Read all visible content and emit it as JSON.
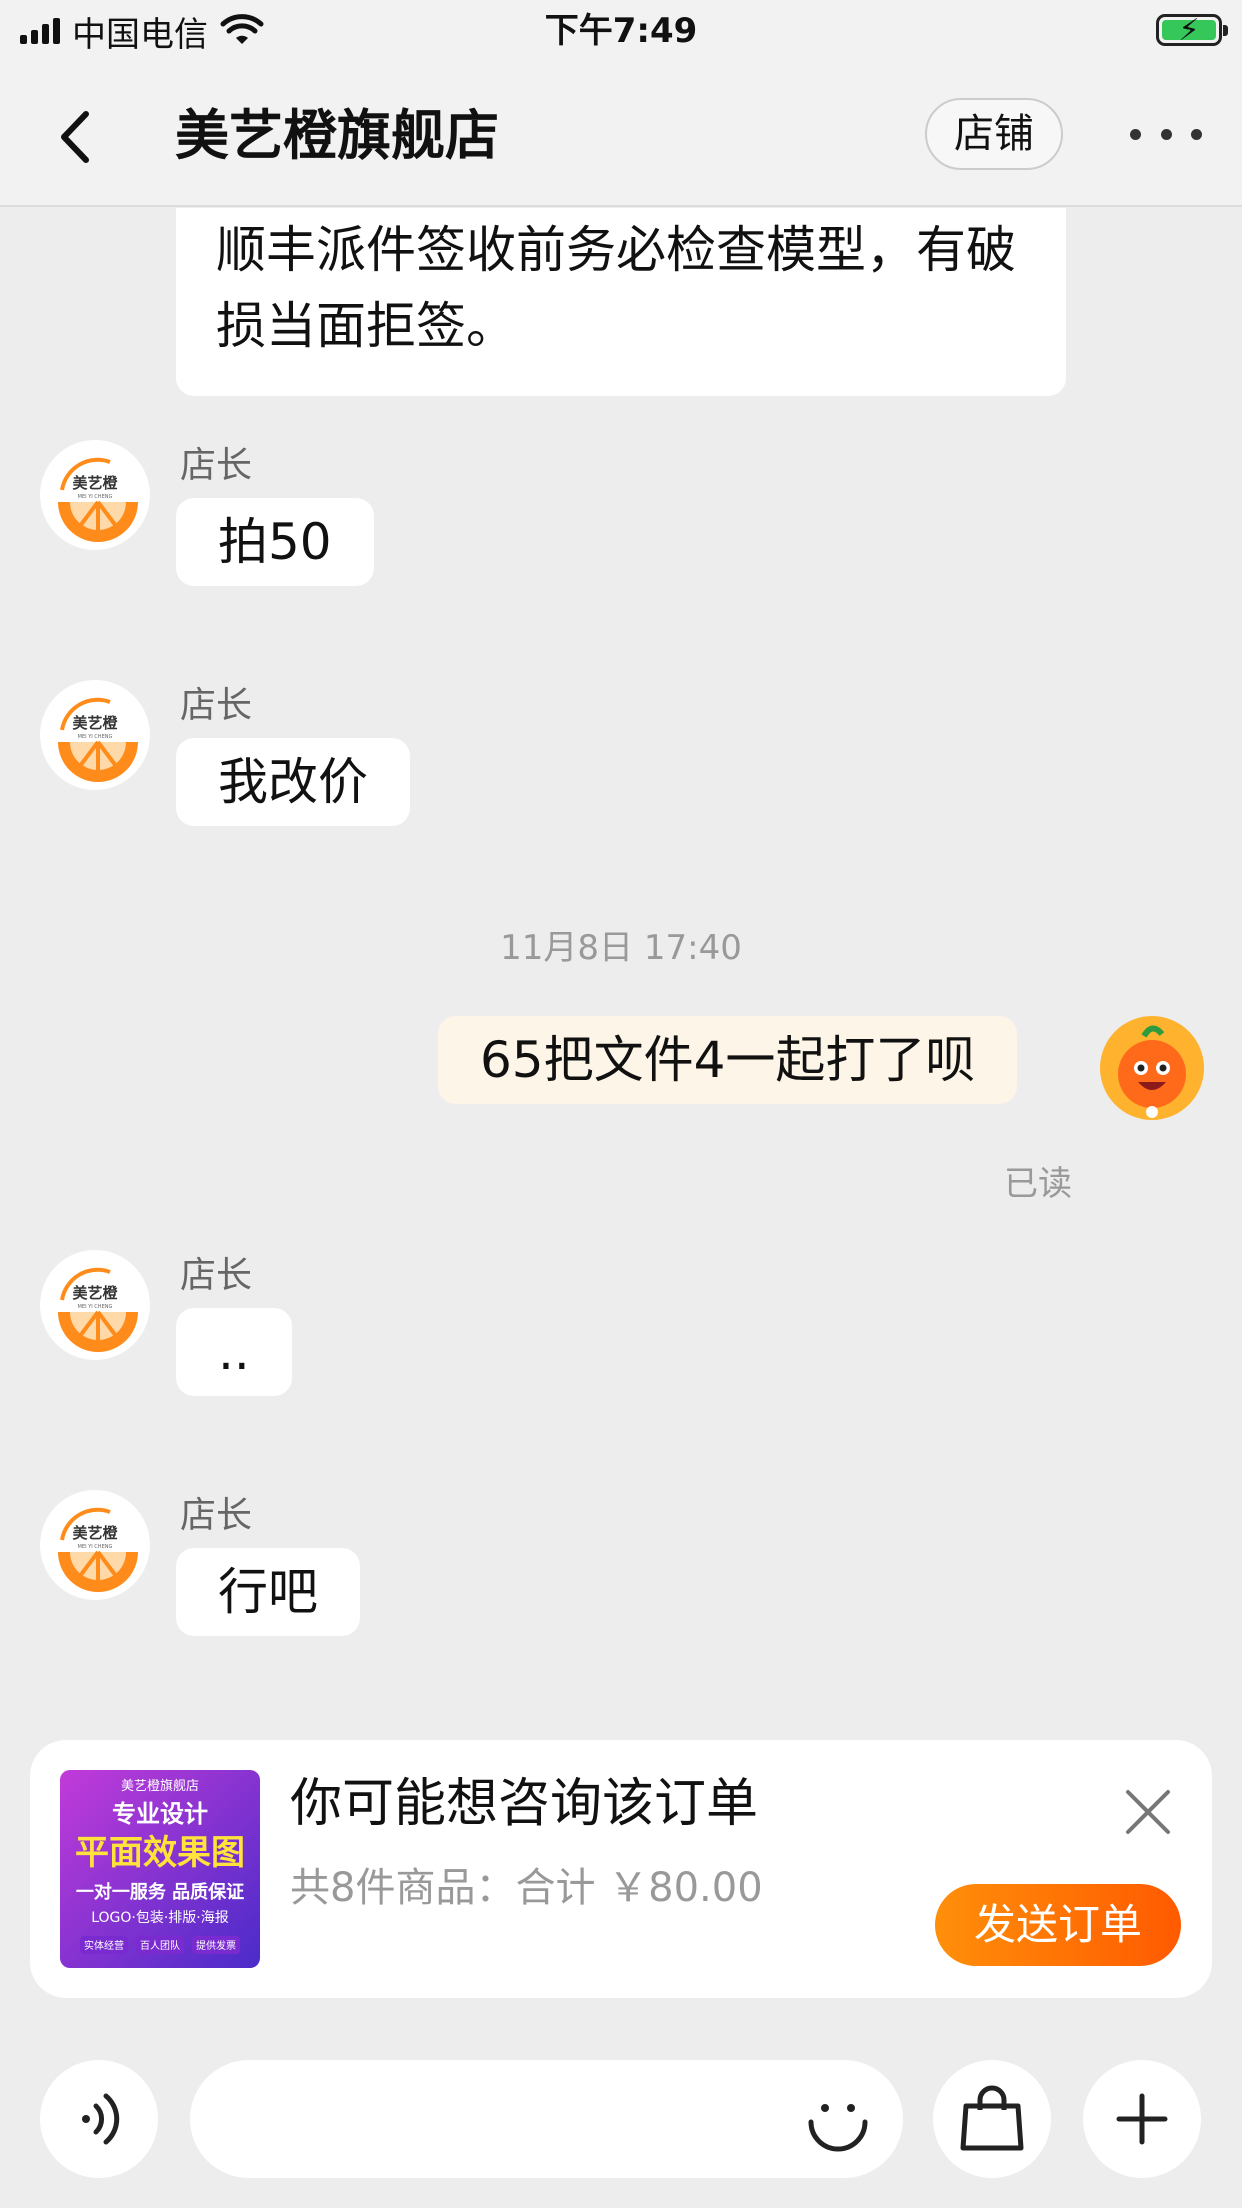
{
  "status_bar": {
    "carrier": "中国电信",
    "time": "下午7:49"
  },
  "nav": {
    "title": "美艺橙旗舰店",
    "shop_button": "店铺"
  },
  "messages": {
    "first_text": "顺丰派件签收前务必检查模型，有破损当面拒签。",
    "sender_name": "店长",
    "m1": "拍50",
    "m2": "我改价",
    "time_divider": "11月8日 17:40",
    "mine": "65把文件4一起打了呗",
    "read_status": "已读",
    "m3": "..",
    "m4": "行吧"
  },
  "avatar_logo_text": "美艺橙",
  "avatar_logo_sub": "MEI YI CHENG",
  "order_card": {
    "title": "你可能想咨询该订单",
    "summary": "共8件商品：合计 ￥80.00",
    "send_button": "发送订单",
    "thumb": {
      "shop": "美艺橙旗舰店",
      "line1": "专业设计",
      "line2": "平面效果图",
      "line3": "一对一服务 品质保证",
      "line4": "LOGO·包装·排版·海报",
      "tags": [
        "实体经营",
        "百人团队",
        "提供发票"
      ]
    }
  },
  "input_bar": {
    "placeholder": ""
  },
  "colors": {
    "accent": "#ff6a00",
    "bubble_mine": "#fdf6e8",
    "background": "#ededed"
  }
}
